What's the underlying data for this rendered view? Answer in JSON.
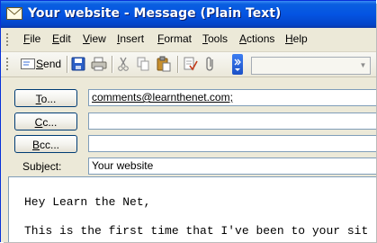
{
  "window": {
    "title": "Your website - Message (Plain Text)"
  },
  "menu": [
    {
      "label": "File",
      "key": "F",
      "rest": "ile"
    },
    {
      "label": "Edit",
      "key": "E",
      "rest": "dit"
    },
    {
      "label": "View",
      "key": "V",
      "rest": "iew"
    },
    {
      "label": "Insert",
      "key": "I",
      "rest": "nsert"
    },
    {
      "label": "Format",
      "key": "F",
      "rest": "ormat"
    },
    {
      "label": "Tools",
      "key": "T",
      "rest": "ools"
    },
    {
      "label": "Actions",
      "key": "A",
      "rest": "ctions"
    },
    {
      "label": "Help",
      "key": "H",
      "rest": "elp"
    }
  ],
  "toolbar": {
    "send_key": "S",
    "send_rest": "end",
    "icons": [
      "envelope-icon",
      "save-icon",
      "print-icon",
      "cut-icon",
      "copy-icon",
      "paste-icon",
      "check-names-icon",
      "attach-icon",
      "toolbar-options-icon"
    ],
    "combo_value": ""
  },
  "fields": {
    "to_key": "T",
    "to_rest": "o...",
    "cc_key": "C",
    "cc_rest": "c...",
    "bcc_key": "B",
    "bcc_rest": "cc...",
    "subject_label": "Subject:",
    "to_value": "comments@learnthenet.com;",
    "cc_value": "",
    "bcc_value": "",
    "subject_value": "Your website"
  },
  "body": {
    "line1": "Hey Learn the Net,",
    "line2": "This is the first time that I've been to your sit"
  }
}
